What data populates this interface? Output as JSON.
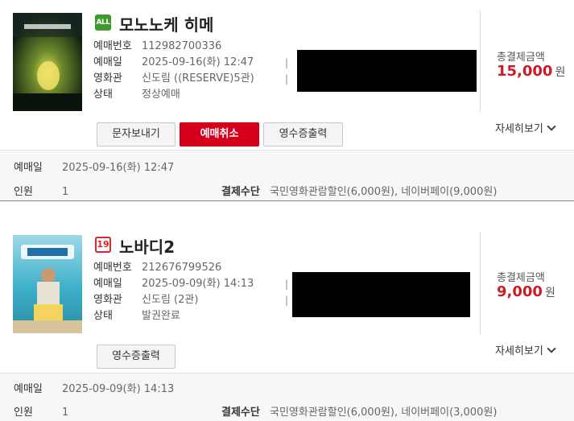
{
  "bookings": [
    {
      "rating_label": "ALL",
      "title": "모노노케 히메",
      "fields": [
        {
          "label": "예매번호",
          "value": "112982700336"
        },
        {
          "label": "예매일",
          "value": "2025-09-16(화) 12:47"
        },
        {
          "label": "영화관",
          "value": "신도림 ((RESERVE)5관)"
        },
        {
          "label": "상태",
          "value": "정상예매"
        }
      ],
      "separators": [
        "|",
        "|"
      ],
      "total_label": "총결제금액",
      "total_amount": "15,000",
      "currency": "원",
      "buttons": [
        "문자보내기",
        "예매취소",
        "영수증출력"
      ],
      "more_label": "자세히보기",
      "detail": {
        "date_label": "예매일",
        "date_value": "2025-09-16(화) 12:47",
        "people_label": "인원",
        "people_value": "1",
        "pay_label": "결제수단",
        "pay_value": "국민영화관람할인(6,000원), 네이버페이(9,000원)"
      }
    },
    {
      "rating_label": "19",
      "title": "노바디2",
      "fields": [
        {
          "label": "예매번호",
          "value": "212676799526"
        },
        {
          "label": "예매일",
          "value": "2025-09-09(화) 14:13"
        },
        {
          "label": "영화관",
          "value": "신도림 (2관)"
        },
        {
          "label": "상태",
          "value": "발권완료"
        }
      ],
      "separators": [
        "|",
        "|"
      ],
      "total_label": "총결제금액",
      "total_amount": "9,000",
      "currency": "원",
      "buttons": [
        "영수증출력"
      ],
      "more_label": "자세히보기",
      "detail": {
        "date_label": "예매일",
        "date_value": "2025-09-09(화) 14:13",
        "people_label": "인원",
        "people_value": "1",
        "pay_label": "결제수단",
        "pay_value": "국민영화관람할인(6,000원), 네이버페이(3,000원)"
      }
    }
  ],
  "colors": {
    "accent_red": "#d6001c",
    "price_red": "#c91c24",
    "rating_all_green": "#3f9a2e",
    "rating_19_red": "#d5262b"
  }
}
